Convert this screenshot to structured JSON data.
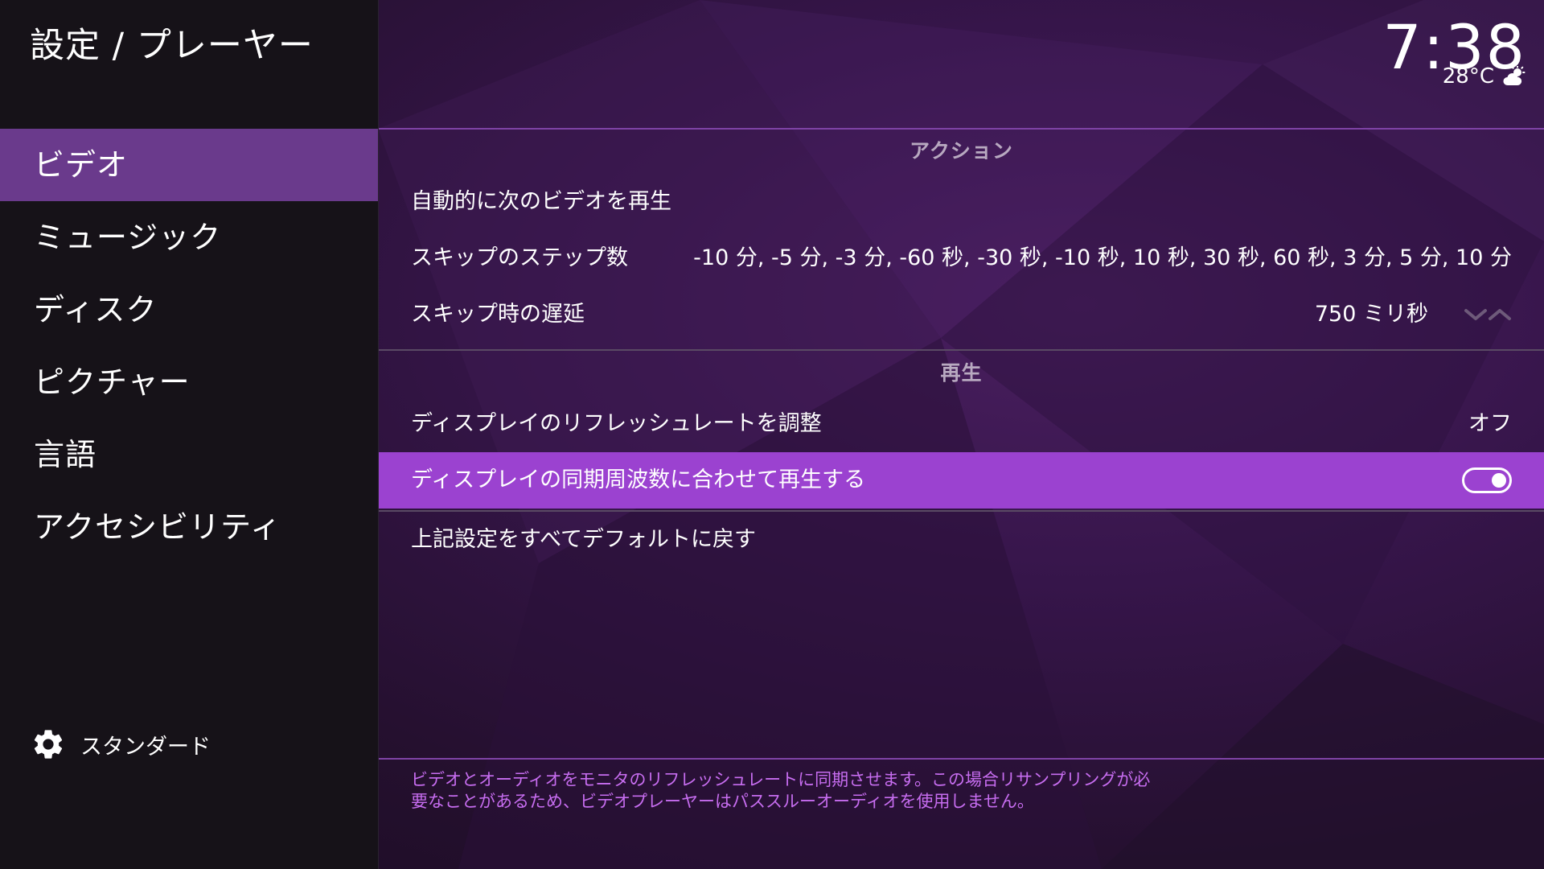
{
  "header": {
    "title": "設定 / プレーヤー",
    "clock": "7:38",
    "temperature": "28°C",
    "weather_icon": "cloud-sun-icon"
  },
  "sidebar": {
    "items": [
      {
        "label": "ビデオ",
        "active": true
      },
      {
        "label": "ミュージック",
        "active": false
      },
      {
        "label": "ディスク",
        "active": false
      },
      {
        "label": "ピクチャー",
        "active": false
      },
      {
        "label": "言語",
        "active": false
      },
      {
        "label": "アクセシビリティ",
        "active": false
      }
    ],
    "level_button": {
      "label": "スタンダード",
      "icon": "gear-icon"
    }
  },
  "groups": {
    "actions": {
      "header": "アクション",
      "autoplay_next": {
        "label": "自動的に次のビデオを再生"
      },
      "skip_steps": {
        "label": "スキップのステップ数",
        "value": "-10 分, -5 分, -3 分, -60 秒, -30 秒, -10 秒, 10 秒, 30 秒, 60 秒, 3 分, 5 分, 10 分"
      },
      "skip_delay": {
        "label": "スキップ時の遅延",
        "value": "750 ミリ秒"
      }
    },
    "playback": {
      "header": "再生",
      "adjust_refresh": {
        "label": "ディスプレイのリフレッシュレートを調整",
        "value": "オフ"
      },
      "sync_display": {
        "label": "ディスプレイの同期周波数に合わせて再生する",
        "enabled": true
      }
    },
    "reset": {
      "label": "上記設定をすべてデフォルトに戻す"
    }
  },
  "description": {
    "line1": "ビデオとオーディオをモニタのリフレッシュレートに同期させます。この場合リサンプリングが必",
    "line2": "要なことがあるため、ビデオプレーヤーはパススルーオーディオを使用しません。"
  },
  "colors": {
    "accent": "#9b42d0",
    "sidebar_active": "#6a3a8c",
    "description_text": "#c76df0"
  }
}
